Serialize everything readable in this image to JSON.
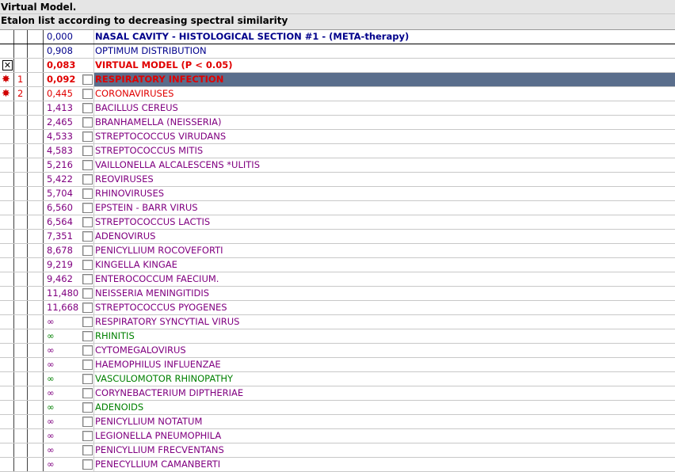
{
  "header": {
    "title": "Virtual Model.",
    "subtitle": "Etalon list according to decreasing spectral similarity"
  },
  "colors": {
    "selected_bg": "#5a6e8c",
    "purple": "#800080",
    "green": "#008000",
    "red": "#e00000",
    "navy": "#00008b"
  },
  "rows": [
    {
      "mark": "",
      "num": "",
      "dist": "0,000",
      "name": "NASAL CAVITY - HISTOLOGICAL SECTION #1 - (META-therapy)",
      "color": "navy",
      "bold": true,
      "checkbox": false
    },
    {
      "mark": "",
      "num": "",
      "dist": "0,908",
      "name": "OPTIMUM DISTRIBUTION",
      "color": "navy",
      "bold": false,
      "checkbox": false
    },
    {
      "mark": "x",
      "num": "",
      "dist": "0,083",
      "name": "VIRTUAL MODEL (P < 0.05)",
      "color": "red",
      "bold": true,
      "checkbox": false
    },
    {
      "mark": "star",
      "num": "1",
      "dist": "0,092",
      "name": "RESPIRATORY  INFECTION",
      "color": "red",
      "bold": true,
      "checkbox": true,
      "selected": true
    },
    {
      "mark": "star",
      "num": "2",
      "dist": "0,445",
      "name": "CORONAVIRUSES",
      "color": "red",
      "bold": false,
      "checkbox": true
    },
    {
      "mark": "",
      "num": "",
      "dist": "1,413",
      "name": "BACILLUS CEREUS",
      "color": "purple",
      "checkbox": true
    },
    {
      "mark": "",
      "num": "",
      "dist": "2,465",
      "name": "BRANHAMELLA (NEISSERIA)",
      "color": "purple",
      "checkbox": true
    },
    {
      "mark": "",
      "num": "",
      "dist": "4,533",
      "name": "STREPTOCOCCUS VIRUDANS",
      "color": "purple",
      "checkbox": true
    },
    {
      "mark": "",
      "num": "",
      "dist": "4,583",
      "name": "STREPTOCOCCUS MITIS",
      "color": "purple",
      "checkbox": true
    },
    {
      "mark": "",
      "num": "",
      "dist": "5,216",
      "name": "VAILLONELLA ALCALESCENS *ULITIS",
      "color": "purple",
      "checkbox": true
    },
    {
      "mark": "",
      "num": "",
      "dist": "5,422",
      "name": "REOVIRUSES",
      "color": "purple",
      "checkbox": true
    },
    {
      "mark": "",
      "num": "",
      "dist": "5,704",
      "name": "RHINOVIRUSES",
      "color": "purple",
      "checkbox": true
    },
    {
      "mark": "",
      "num": "",
      "dist": "6,560",
      "name": "EPSTEIN - BARR VIRUS",
      "color": "purple",
      "checkbox": true
    },
    {
      "mark": "",
      "num": "",
      "dist": "6,564",
      "name": "STREPTOCOCCUS LACTIS",
      "color": "purple",
      "checkbox": true
    },
    {
      "mark": "",
      "num": "",
      "dist": "7,351",
      "name": "ADENOVIRUS",
      "color": "purple",
      "checkbox": true
    },
    {
      "mark": "",
      "num": "",
      "dist": "8,678",
      "name": "PENICYLLIUM  ROCOVEFORTI",
      "color": "purple",
      "checkbox": true
    },
    {
      "mark": "",
      "num": "",
      "dist": "9,219",
      "name": "KINGELLA  KINGAE",
      "color": "purple",
      "checkbox": true
    },
    {
      "mark": "",
      "num": "",
      "dist": "9,462",
      "name": "ENTEROCOCCUM  FAECIUM.",
      "color": "purple",
      "checkbox": true
    },
    {
      "mark": "",
      "num": "",
      "dist": "11,480",
      "name": "NEISSERIA  MENINGITIDIS",
      "color": "purple",
      "checkbox": true
    },
    {
      "mark": "",
      "num": "",
      "dist": "11,668",
      "name": "STREPTOCOCCUS PYOGENES",
      "color": "purple",
      "checkbox": true
    },
    {
      "mark": "",
      "num": "",
      "dist": "∞",
      "name": "RESPIRATORY SYNCYTIAL VIRUS",
      "color": "purple",
      "checkbox": true
    },
    {
      "mark": "",
      "num": "",
      "dist": "∞",
      "name": "RHINITIS",
      "color": "green",
      "checkbox": true
    },
    {
      "mark": "",
      "num": "",
      "dist": "∞",
      "name": "CYTOMEGALOVIRUS",
      "color": "purple",
      "checkbox": true
    },
    {
      "mark": "",
      "num": "",
      "dist": "∞",
      "name": "HAEMOPHILUS INFLUENZAE",
      "color": "purple",
      "checkbox": true
    },
    {
      "mark": "",
      "num": "",
      "dist": "∞",
      "name": "VASCULOMOTOR   RHINOPATHY",
      "color": "green",
      "checkbox": true
    },
    {
      "mark": "",
      "num": "",
      "dist": "∞",
      "name": "CORYNEBACTERIUM  DIPTHERIAE",
      "color": "purple",
      "checkbox": true
    },
    {
      "mark": "",
      "num": "",
      "dist": "∞",
      "name": "ADENOIDS",
      "color": "green",
      "checkbox": true
    },
    {
      "mark": "",
      "num": "",
      "dist": "∞",
      "name": "PENICYLLIUM  NOTATUM",
      "color": "purple",
      "checkbox": true
    },
    {
      "mark": "",
      "num": "",
      "dist": "∞",
      "name": "LEGIONELLA  PNEUMOPHILA",
      "color": "purple",
      "checkbox": true
    },
    {
      "mark": "",
      "num": "",
      "dist": "∞",
      "name": "PENICYLLIUM  FRECVENTANS",
      "color": "purple",
      "checkbox": true
    },
    {
      "mark": "",
      "num": "",
      "dist": "∞",
      "name": "PENECYLLIUM  CAMANBERTI",
      "color": "purple",
      "checkbox": true
    }
  ]
}
